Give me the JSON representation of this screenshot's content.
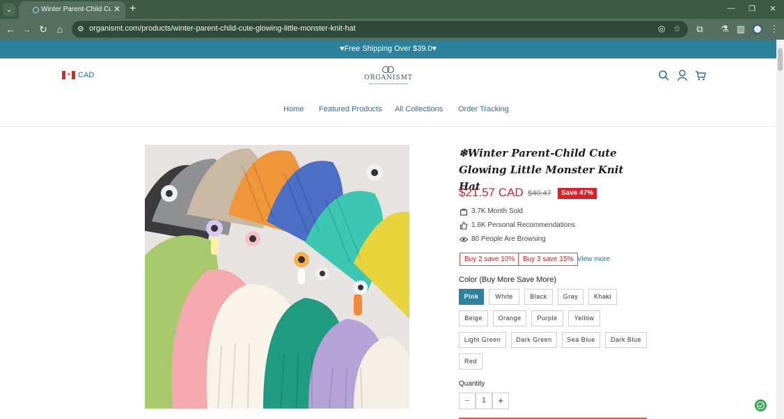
{
  "browser": {
    "tab_title": "Winter Parent-Child Cute Gl",
    "new_tab": "+",
    "url": "organismt.com/products/winter-parent-child-cute-glowing-little-monster-knit-hat"
  },
  "announcement": "♥Free Shipping Over $39.0♥",
  "header": {
    "currency": "CAD",
    "logo_text": "ORGANISMT"
  },
  "nav": {
    "items": [
      "Home",
      "Featured Products",
      "All Collections",
      "Order Tracking"
    ]
  },
  "product": {
    "title": "❄Winter Parent-Child Cute Glowing Little Monster Knit Hat",
    "price": "$21.57 CAD",
    "compare_price": "$40.47",
    "save_badge": "Save 47%",
    "stats": {
      "sold": "3.7K Month Sold",
      "recommendations": "1.6K Personal Recommendations",
      "browsing": "80 People Are Browsing"
    },
    "promos": [
      "Buy 2 save 10%",
      "Buy 3 save 15%"
    ],
    "view_more": "View more",
    "color_label": "Color  (Buy More Save More)",
    "colors": [
      "Pink",
      "White",
      "Black",
      "Gray",
      "Khaki",
      "Beige",
      "Orange",
      "Purple",
      "Yellow",
      "Light Green",
      "Dark Green",
      "Sea Blue",
      "Dark Blue",
      "Red"
    ],
    "selected_color": "Pink",
    "quantity_label": "Quantity",
    "quantity": "1",
    "qty_minus": "−",
    "qty_plus": "+"
  },
  "colors": {
    "announcement_bg": "#2c819c",
    "price": "#d6232b",
    "link": "#2c6f98",
    "browser_chrome": "#557060"
  }
}
